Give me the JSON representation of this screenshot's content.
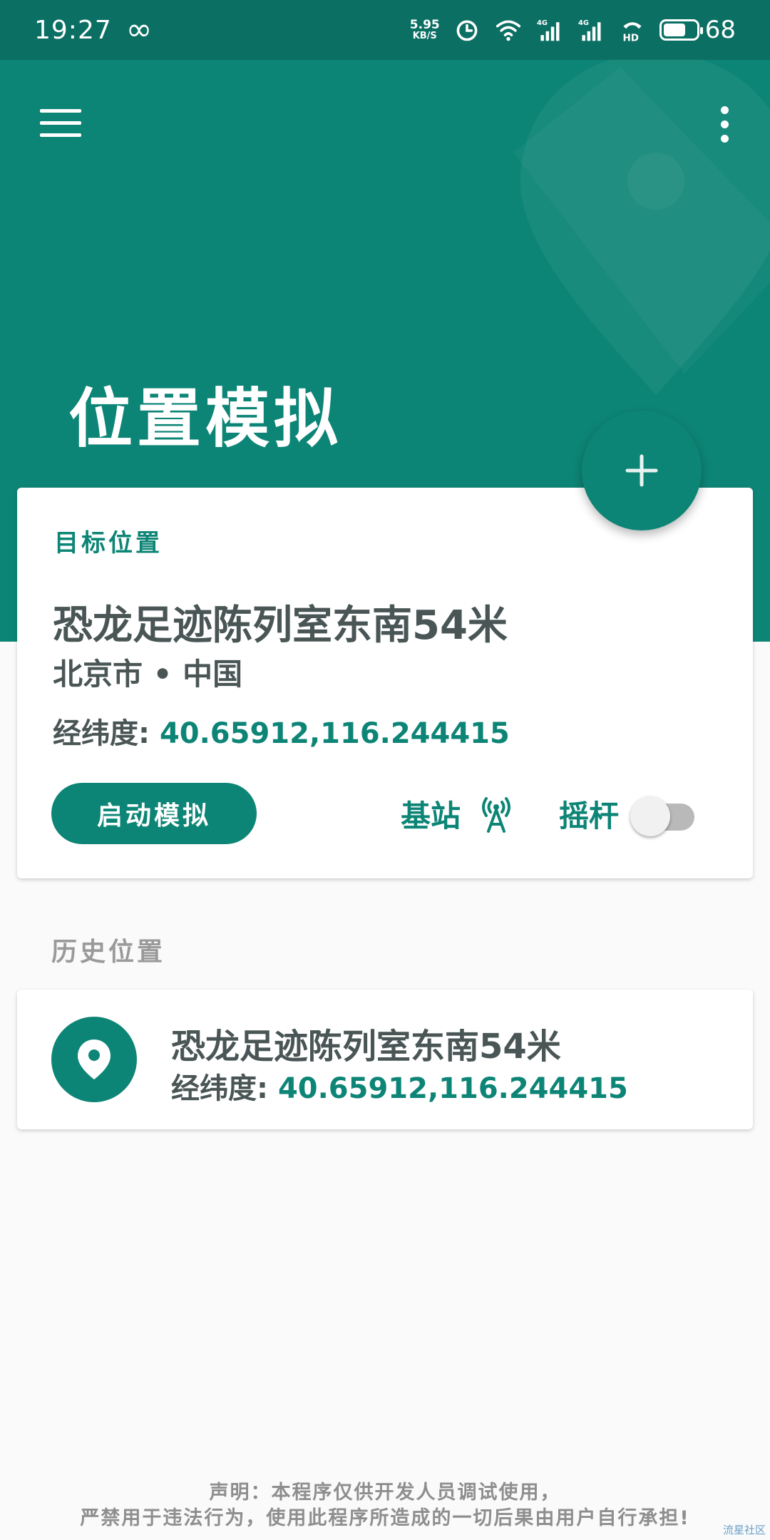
{
  "status_bar": {
    "time": "19:27",
    "speed_value": "5.95",
    "speed_unit": "KB/S",
    "battery": "68",
    "icons": [
      "infinity-icon",
      "alarm-icon",
      "wifi-icon",
      "signal-4g-icon",
      "signal-4g-icon",
      "hd-call-icon",
      "battery-icon"
    ]
  },
  "header": {
    "title": "位置模拟",
    "menu_icon": "hamburger-menu-icon",
    "more_icon": "more-vert-icon",
    "background_color": "#0d8576"
  },
  "fab": {
    "icon": "add-icon"
  },
  "target": {
    "section_label": "目标位置",
    "name": "恐龙足迹陈列室东南54米",
    "region": "北京市 • 中国",
    "coord_label": "经纬度:",
    "coord_value": "40.65912,116.244415",
    "start_button": "启动模拟",
    "basestation_label": "基站",
    "basestation_icon": "cell-tower-icon",
    "joystick_label": "摇杆",
    "joystick_enabled": false
  },
  "history": {
    "heading": "历史位置",
    "items": [
      {
        "name": "恐龙足迹陈列室东南54米",
        "coord_label": "经纬度:",
        "coord_value": "40.65912,116.244415",
        "icon": "location-pin-icon"
      }
    ]
  },
  "disclaimer": {
    "line1": "声明：本程序仅供开发人员调试使用，",
    "line2": "严禁用于违法行为，使用此程序所造成的一切后果由用户自行承担!"
  },
  "watermark": "流星社区",
  "colors": {
    "primary": "#0d8576",
    "status_bar": "#0b6f63",
    "text_dark": "#4a5555",
    "text_muted": "#9a9a9a",
    "background": "#fafafa"
  }
}
